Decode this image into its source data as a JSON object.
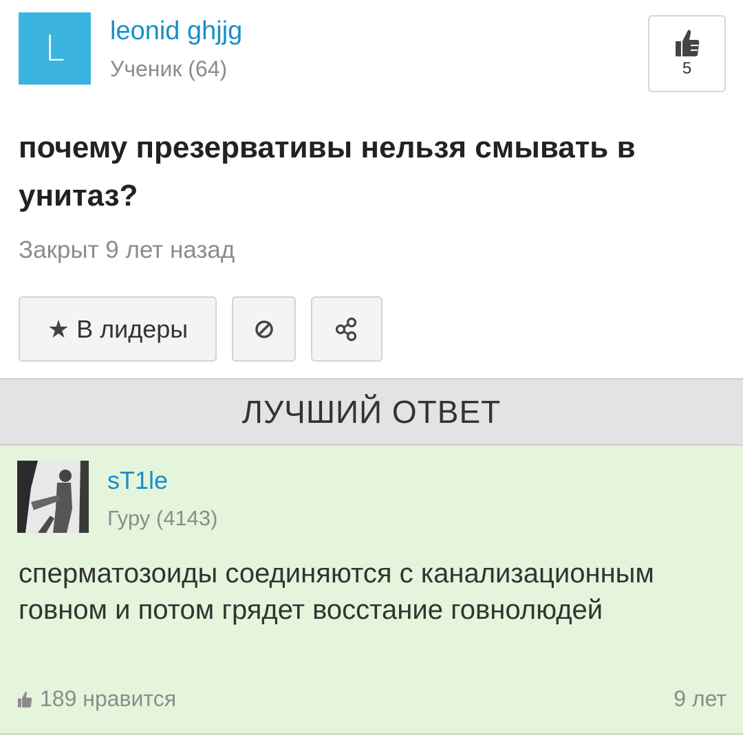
{
  "question": {
    "author": {
      "initial": "L",
      "name": "leonid ghjjg",
      "rank": "Ученик (64)",
      "avatar_color": "#3cb4e0"
    },
    "likes": "5",
    "title": "почему презервативы нельзя смывать в унитаз?",
    "status": "Закрыт 9 лет назад"
  },
  "actions": {
    "leaders_label": "В лидеры",
    "star_icon": "star-icon",
    "report_icon": "block-icon",
    "share_icon": "share-icon"
  },
  "best_answer": {
    "header": "ЛУЧШИЙ ОТВЕТ",
    "author": {
      "name": "sT1le",
      "rank": "Гуру (4143)"
    },
    "text": "сперматозоиды соединяются с канализационным говном и потом грядет восстание говнолюдей",
    "likes": "189 нравится",
    "age": "9 лет",
    "background": "#e4f5db"
  },
  "colors": {
    "link": "#1a8ec9",
    "muted": "#8c8c8c"
  }
}
